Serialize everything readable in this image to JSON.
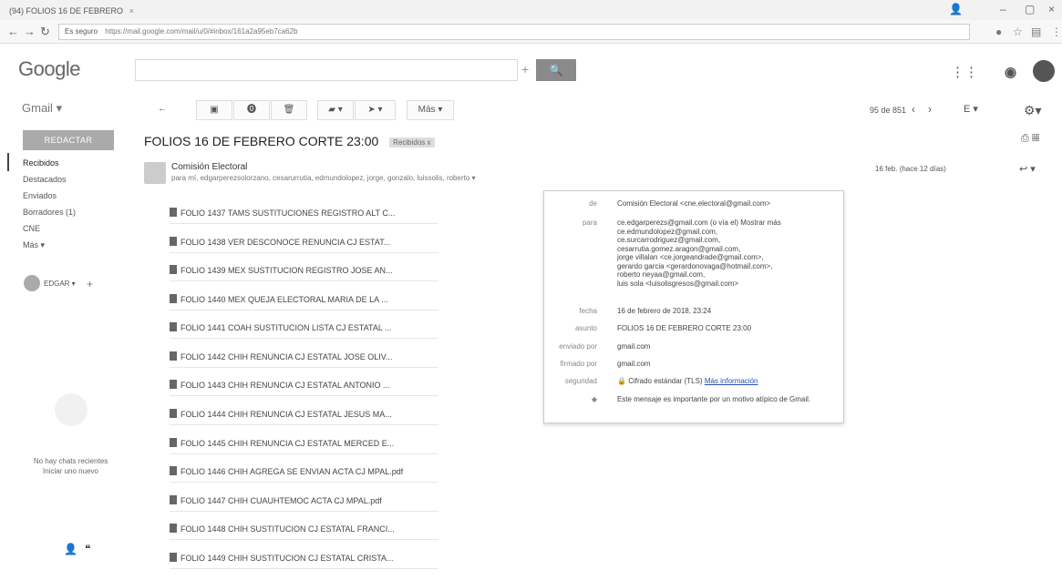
{
  "browser": {
    "tab_title": "(94) FOLIOS 16 DE FEBRERO",
    "secure_label": "Es seguro",
    "url": "https://mail.google.com/mail/u/0/#inbox/161a2a95eb7ca62b"
  },
  "gmail": {
    "logo": "Google",
    "product_label": "Gmail",
    "compose_label": "REDACTAR",
    "nav": [
      {
        "label": "Recibidos"
      },
      {
        "label": "Destacados"
      },
      {
        "label": "Enviados"
      },
      {
        "label": "Borradores (1)"
      },
      {
        "label": "CNE"
      },
      {
        "label": "Más"
      }
    ],
    "hangouts_user": "EDGAR",
    "no_chats_line1": "No hay chats recientes",
    "no_chats_line2": "Iniciar uno nuevo"
  },
  "toolbar": {
    "more_label": "Más",
    "pager": "95 de 851"
  },
  "thread": {
    "subject": "FOLIOS 16 DE FEBRERO CORTE 23:00",
    "label_chip": "Recibidos x",
    "sender_name": "Comisión Electoral",
    "to_line": "para mí, edgarperezsolorzano, cesarurrutia, edmundolopez, jorge, gonzalo, luissolis, roberto",
    "date": "16 feb. (hace 12 días)"
  },
  "attachments": [
    {
      "name": "FOLIO 1437 TAMS SUSTITUCIONES REGISTRO ALT C..."
    },
    {
      "name": "FOLIO 1438 VER DESCONOCE RENUNCIA CJ ESTAT..."
    },
    {
      "name": "FOLIO 1439 MEX SUSTITUCION REGISTRO JOSE AN..."
    },
    {
      "name": "FOLIO 1440 MEX QUEJA ELECTORAL MARIA DE LA ..."
    },
    {
      "name": "FOLIO 1441 COAH SUSTITUCION LISTA CJ ESTATAL ..."
    },
    {
      "name": "FOLIO 1442 CHIH RENUNCIA CJ ESTATAL JOSE OLIV..."
    },
    {
      "name": "FOLIO 1443 CHIH RENUNCIA CJ ESTATAL ANTONIO ..."
    },
    {
      "name": "FOLIO 1444 CHIH RENUNCIA CJ ESTATAL JESUS MA..."
    },
    {
      "name": "FOLIO 1445 CHIH RENUNCIA CJ ESTATAL MERCED E..."
    },
    {
      "name": "FOLIO 1446 CHIH AGREGA SE ENVIAN ACTA CJ MPAL.pdf"
    },
    {
      "name": "FOLIO 1447 CHIH CUAUHTEMOC ACTA CJ MPAL.pdf"
    },
    {
      "name": "FOLIO 1448 CHIH SUSTITUCION CJ ESTATAL FRANCI..."
    },
    {
      "name": "FOLIO 1449 CHIH SUSTITUCION CJ ESTATAL CRISTA..."
    }
  ],
  "details": {
    "de_label": "de",
    "de_value": "Comisión Electoral <cne.electoral@gmail.com>",
    "para_label": "para",
    "para_lines": [
      "ce.edgarperezs@gmail.com (o vía el) Mostrar más",
      "ce.edmundolopez@gmail.com,",
      "ce.surcarrodriguez@gmail.com,",
      "cesarrutia.gomez.aragon@gmail.com,",
      "jorge villalan <ce.jorgeandrade@gmail.com>,",
      "gerardo garcia <gerardonovaga@hotmail.com>,",
      "roberto neyaa@gmail.com,",
      "luis sola <luisolisgresos@gmail.com>"
    ],
    "fecha_label": "fecha",
    "fecha_value": "16 de febrero de 2018, 23:24",
    "asunto_label": "asunto",
    "asunto_value": "FOLIOS 16 DE FEBRERO CORTE 23:00",
    "enviado_label": "enviado por",
    "enviado_value": "gmail.com",
    "firmado_label": "firmado por",
    "firmado_value": "gmail.com",
    "seguridad_label": "seguridad",
    "seguridad_value": "Cifrado estándar (TLS)",
    "seguridad_link": "Más información",
    "importance_value": "Este mensaje es importante por un motivo atípico de Gmail."
  }
}
